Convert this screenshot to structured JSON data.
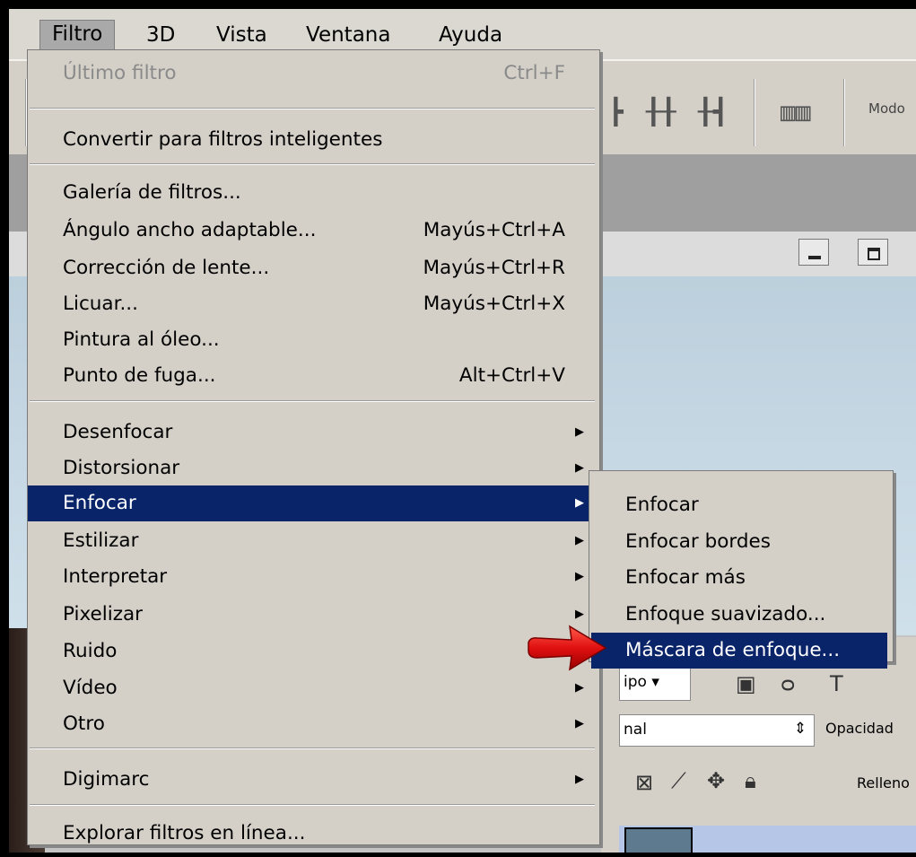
{
  "menubar": {
    "items": [
      {
        "label": "Filtro",
        "active": true
      },
      {
        "label": "3D"
      },
      {
        "label": "Vista"
      },
      {
        "label": "Ventana"
      },
      {
        "label": "Ayuda"
      }
    ]
  },
  "toolbar": {
    "mode_label": "Modo"
  },
  "layers_panel": {
    "kind_value": "ipo",
    "blend_value": "nal",
    "opacity_label": "Opacidad",
    "fill_label": "Relleno"
  },
  "filter_menu": {
    "items": [
      {
        "label": "Último filtro",
        "shortcut": "Ctrl+F",
        "disabled": true
      },
      {
        "label": "Convertir para filtros inteligentes"
      },
      {
        "label": "Galería de filtros..."
      },
      {
        "label": "Ángulo ancho adaptable...",
        "shortcut": "Mayús+Ctrl+A"
      },
      {
        "label": "Corrección de lente...",
        "shortcut": "Mayús+Ctrl+R"
      },
      {
        "label": "Licuar...",
        "shortcut": "Mayús+Ctrl+X"
      },
      {
        "label": "Pintura al óleo..."
      },
      {
        "label": "Punto de fuga...",
        "shortcut": "Alt+Ctrl+V"
      },
      {
        "label": "Desenfocar",
        "submenu": true
      },
      {
        "label": "Distorsionar",
        "submenu": true
      },
      {
        "label": "Enfocar",
        "submenu": true,
        "selected": true
      },
      {
        "label": "Estilizar",
        "submenu": true
      },
      {
        "label": "Interpretar",
        "submenu": true
      },
      {
        "label": "Pixelizar",
        "submenu": true
      },
      {
        "label": "Ruido",
        "submenu": true
      },
      {
        "label": "Vídeo",
        "submenu": true
      },
      {
        "label": "Otro",
        "submenu": true
      },
      {
        "label": "Digimarc",
        "submenu": true
      },
      {
        "label": "Explorar filtros en línea..."
      }
    ]
  },
  "enfocar_submenu": {
    "items": [
      {
        "label": "Enfocar"
      },
      {
        "label": "Enfocar bordes"
      },
      {
        "label": "Enfocar más"
      },
      {
        "label": "Enfoque suavizado..."
      },
      {
        "label": "Máscara de enfoque...",
        "selected": true
      }
    ]
  },
  "colors": {
    "selection": "#0a246a",
    "menu_bg": "#d4d0c8",
    "arrow": "#e01010"
  },
  "icons": {
    "submenu_arrow": "triangle-right-icon",
    "pointer": "red-arrow-icon"
  }
}
